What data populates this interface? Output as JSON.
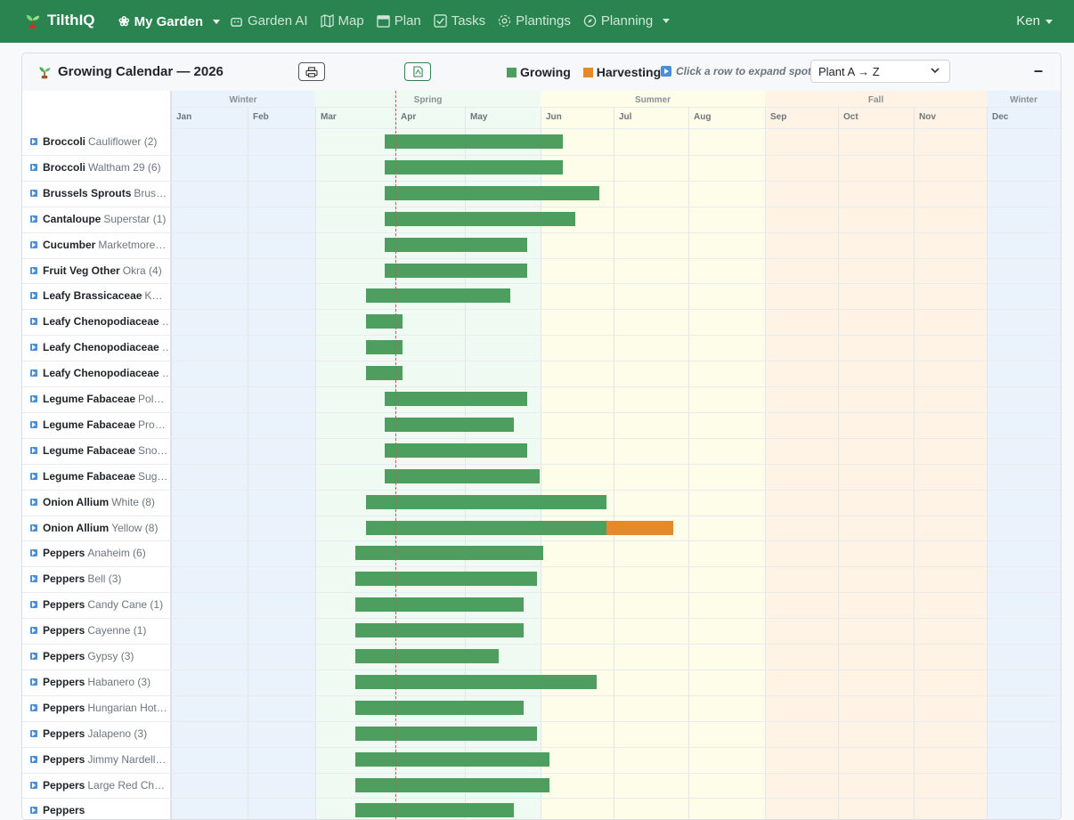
{
  "nav": {
    "brand": "TilthIQ",
    "garden_selector": "My Garden",
    "items": [
      {
        "label": "Garden AI",
        "icon": "robot-icon"
      },
      {
        "label": "Map",
        "icon": "map-icon"
      },
      {
        "label": "Plan",
        "icon": "calendar-icon"
      },
      {
        "label": "Tasks",
        "icon": "checkbox-icon"
      },
      {
        "label": "Plantings",
        "icon": "flower-icon"
      },
      {
        "label": "Planning",
        "icon": "compass-icon",
        "dropdown": true
      }
    ],
    "user": "Ken"
  },
  "card": {
    "title": "Growing Calendar — 2026",
    "print_icon": "printer-icon",
    "pdf_icon": "pdf-icon",
    "legend": {
      "growing": "Growing",
      "harvesting": "Harvesting"
    },
    "hint": "Click a row to expand spots",
    "sort_value": "Plant A → Z",
    "collapse_label": "–"
  },
  "colors": {
    "growing": "#4e9e5f",
    "harvesting": "#e68a29",
    "nav": "#2a8450"
  },
  "seasons": [
    "Winter",
    "Spring",
    "Summer",
    "Fall",
    "Winter"
  ],
  "months": [
    "Jan",
    "Feb",
    "Mar",
    "Apr",
    "May",
    "Jun",
    "Jul",
    "Aug",
    "Sep",
    "Oct",
    "Nov",
    "Dec"
  ],
  "rows": [
    {
      "plant": "Broccoli",
      "variety": "Cauliflower (2)",
      "start": 2.87,
      "end": 5.31
    },
    {
      "plant": "Broccoli",
      "variety": "Waltham 29 (6)",
      "start": 2.87,
      "end": 5.31
    },
    {
      "plant": "Brussels Sprouts",
      "variety": "Brusse…",
      "start": 2.87,
      "end": 5.8
    },
    {
      "plant": "Cantaloupe",
      "variety": "Superstar (1)",
      "start": 2.87,
      "end": 5.48
    },
    {
      "plant": "Cucumber",
      "variety": "Marketmore…",
      "start": 2.87,
      "end": 4.82
    },
    {
      "plant": "Fruit Veg Other",
      "variety": "Okra (4)",
      "start": 2.87,
      "end": 4.82
    },
    {
      "plant": "Leafy Brassicaceae",
      "variety": "Kale…",
      "start": 2.63,
      "end": 4.6
    },
    {
      "plant": "Leafy Chenopodiaceae",
      "variety": "…",
      "start": 2.63,
      "end": 3.1
    },
    {
      "plant": "Leafy Chenopodiaceae",
      "variety": "…",
      "start": 2.63,
      "end": 3.1
    },
    {
      "plant": "Leafy Chenopodiaceae",
      "variety": "…",
      "start": 2.63,
      "end": 3.1
    },
    {
      "plant": "Legume Fabaceae",
      "variety": "Pole …",
      "start": 2.87,
      "end": 4.82
    },
    {
      "plant": "Legume Fabaceae",
      "variety": "Provi…",
      "start": 2.87,
      "end": 4.65
    },
    {
      "plant": "Legume Fabaceae",
      "variety": "Snow…",
      "start": 2.87,
      "end": 4.82
    },
    {
      "plant": "Legume Fabaceae",
      "variety": "Suga…",
      "start": 2.87,
      "end": 4.99
    },
    {
      "plant": "Onion Allium",
      "variety": "White (8)",
      "start": 2.63,
      "end": 5.9
    },
    {
      "plant": "Onion Allium",
      "variety": "Yellow (8)",
      "start": 2.63,
      "end": 5.9,
      "harvest_end": 6.8
    },
    {
      "plant": "Peppers",
      "variety": "Anaheim (6)",
      "start": 2.5,
      "end": 5.04
    },
    {
      "plant": "Peppers",
      "variety": "Bell (3)",
      "start": 2.5,
      "end": 4.95
    },
    {
      "plant": "Peppers",
      "variety": "Candy Cane (1)",
      "start": 2.5,
      "end": 4.78
    },
    {
      "plant": "Peppers",
      "variety": "Cayenne (1)",
      "start": 2.5,
      "end": 4.78
    },
    {
      "plant": "Peppers",
      "variety": "Gypsy (3)",
      "start": 2.5,
      "end": 4.45
    },
    {
      "plant": "Peppers",
      "variety": "Habanero (3)",
      "start": 2.5,
      "end": 5.77
    },
    {
      "plant": "Peppers",
      "variety": "Hungarian Hot …",
      "start": 2.5,
      "end": 4.78
    },
    {
      "plant": "Peppers",
      "variety": "Jalapeno (3)",
      "start": 2.5,
      "end": 4.95
    },
    {
      "plant": "Peppers",
      "variety": "Jimmy Nardello…",
      "start": 2.5,
      "end": 5.12
    },
    {
      "plant": "Peppers",
      "variety": "Large Red Cher…",
      "start": 2.5,
      "end": 5.12
    },
    {
      "plant": "Peppers",
      "variety": "",
      "start": 2.5,
      "end": 4.65
    }
  ]
}
